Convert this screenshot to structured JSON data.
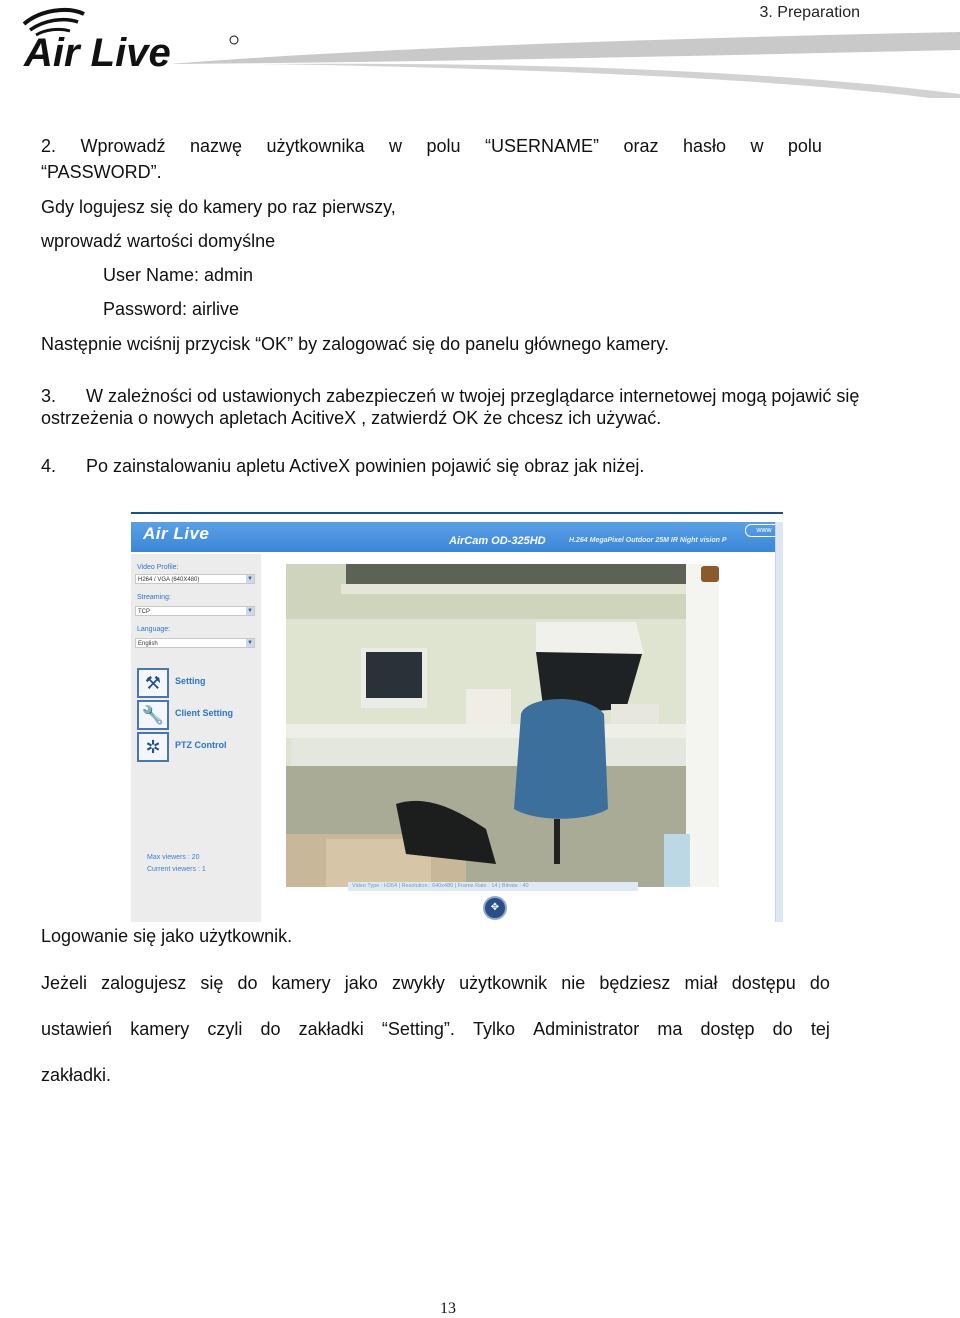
{
  "header": {
    "brand": "Air Live",
    "section_title": "3. Preparation"
  },
  "step2": {
    "number": "2.",
    "line1_words": [
      "Wprowadź",
      "nazwę",
      "użytkownika",
      "w",
      "polu",
      "“USERNAME”",
      "oraz",
      "hasło",
      "w",
      "polu"
    ],
    "line1_rest": "“PASSWORD”.",
    "first_login": "Gdy logujesz się do kamery po raz pierwszy,",
    "defaults_intro": "wprowadź wartości domyślne",
    "username_line": "User Name: admin",
    "password_line": "Password: airlive",
    "ok_line": "Następnie wciśnij przycisk “OK” by zalogować się do panelu głównego kamery."
  },
  "step3": {
    "number": "3.",
    "line1": "W zależności od ustawionych zabezpieczeń w twojej przeglądarce internetowej mogą pojawić się",
    "line2": "ostrzeżenia o nowych apletach AcitiveX , zatwierdź OK że chcesz ich używać."
  },
  "step4": {
    "number": "4.",
    "text": "Po zainstalowaniu apletu ActiveX powinien pojawić się obraz jak niżej."
  },
  "camera_ui": {
    "brand": "Air Live",
    "model": "AirCam OD-325HD",
    "subtitle": "H.264 MegaPixel Outdoor 25M IR Night vision P",
    "www_button": "www",
    "video_profile_label": "Video Profile:",
    "video_profile_value": "H264 / VGA (640X480)",
    "streaming_label": "Streaming:",
    "streaming_value": "TCP",
    "language_label": "Language:",
    "language_value": "English",
    "menu": [
      {
        "label": "Setting",
        "icon": "tools-icon"
      },
      {
        "label": "Client Setting",
        "icon": "wrench-icon"
      },
      {
        "label": "PTZ Control",
        "icon": "ptz-icon"
      }
    ],
    "max_viewers": "Max viewers : 20",
    "current_viewers": "Current viewers : 1",
    "status_bar": "Video Type : H264  |  Resolution : 640x480  |  Frame Rate : 14  |  Bitrate : 40",
    "accent_color": "#3b86d8"
  },
  "user_login": {
    "heading": "Logowanie się jako użytkownik.",
    "line1_words": [
      "Jeżeli",
      "zalogujesz",
      "się",
      "do",
      "kamery",
      "jako",
      "zwykły",
      "użytkownik",
      "nie",
      "będziesz",
      "miał",
      "dostępu",
      "do"
    ],
    "line2_words": [
      "ustawień",
      "kamery",
      "czyli",
      "do",
      "zakładki",
      "“Setting”.",
      "Tylko",
      "Administrator",
      "ma",
      "dostęp",
      "do",
      "tej"
    ],
    "line3": "zakładki."
  },
  "footer": {
    "page_number": "13"
  }
}
